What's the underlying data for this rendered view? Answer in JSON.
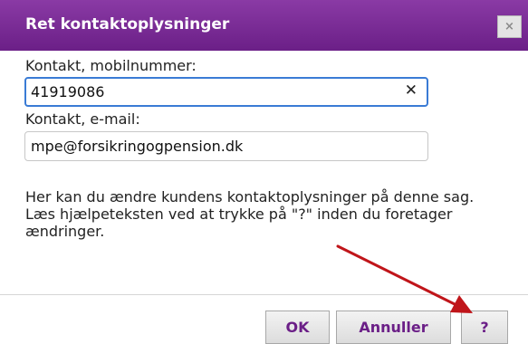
{
  "dialog": {
    "title": "Ret kontaktoplysninger",
    "close_glyph": "×"
  },
  "form": {
    "mobile_label": "Kontakt, mobilnummer:",
    "mobile_value": "41919086",
    "clear_glyph": "✕",
    "email_label": "Kontakt, e-mail:",
    "email_value": "mpe@forsikringogpension.dk"
  },
  "help_text": "Her kan du ændre kundens kontaktoplysninger på denne sag. Læs hjælpeteksten ved at trykke på \"?\" inden du foretager ændringer.",
  "buttons": {
    "ok": "OK",
    "cancel": "Annuller",
    "help": "?"
  },
  "colors": {
    "title_bar": "#7a2b96",
    "button_text": "#6b1f87",
    "focus_border": "#3a7bd5",
    "arrow": "#c0151a"
  },
  "icons": {
    "close": "close-icon",
    "clear": "clear-icon",
    "arrow": "arrow-annotation"
  }
}
